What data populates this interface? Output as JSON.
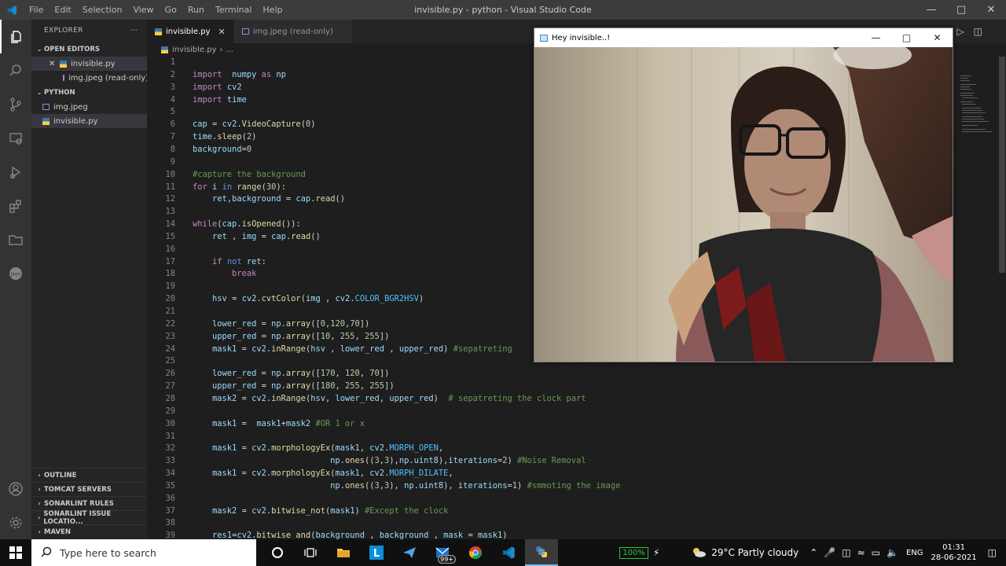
{
  "titlebar": {
    "menu": [
      "File",
      "Edit",
      "Selection",
      "View",
      "Go",
      "Run",
      "Terminal",
      "Help"
    ],
    "title": "invisible.py - python - Visual Studio Code"
  },
  "sidebar": {
    "header": "EXPLORER",
    "open_editors_label": "OPEN EDITORS",
    "open_editors": [
      "invisible.py",
      "img.jpeg (read-only)"
    ],
    "folder_label": "PYTHON",
    "files": [
      "img.jpeg",
      "invisible.py"
    ],
    "bottom_sections": [
      "OUTLINE",
      "TOMCAT SERVERS",
      "SONARLINT RULES",
      "SONARLINT ISSUE LOCATIO...",
      "MAVEN"
    ]
  },
  "tabs": [
    {
      "label": "invisible.py",
      "active": true
    },
    {
      "label": "img.jpeg (read-only)",
      "active": false
    }
  ],
  "breadcrumb": {
    "file": "invisible.py",
    "rest": "..."
  },
  "editor": {
    "line_numbers": [
      "1",
      "2",
      "3",
      "4",
      "5",
      "6",
      "7",
      "8",
      "9",
      "10",
      "11",
      "12",
      "13",
      "14",
      "15",
      "16",
      "17",
      "18",
      "19",
      "20",
      "21",
      "22",
      "23",
      "24",
      "25",
      "26",
      "27",
      "28",
      "29",
      "30",
      "31",
      "32",
      "33",
      "34",
      "35",
      "36",
      "37",
      "38",
      "39"
    ]
  },
  "opencv_window": {
    "title": "Hey invisible..!"
  },
  "taskbar": {
    "search_placeholder": "Type here to search",
    "mail_badge": "99+",
    "battery": "100%",
    "weather": "29°C  Partly cloudy",
    "language": "ENG",
    "time": "01:31",
    "date": "28-06-2021"
  },
  "colors": {
    "titlebar": "#3c3c3c",
    "activity_bar": "#333333",
    "sidebar": "#252526",
    "editor_bg": "#1e1e1e",
    "accent": "#007acc"
  }
}
